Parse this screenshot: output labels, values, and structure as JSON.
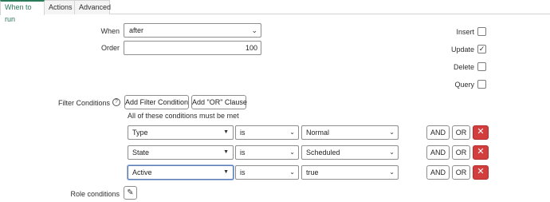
{
  "tabs": [
    "When to run",
    "Actions",
    "Advanced"
  ],
  "form": {
    "when_label": "When",
    "when_value": "after",
    "order_label": "Order",
    "order_value": "100",
    "insert_label": "Insert",
    "update_label": "Update",
    "delete_label": "Delete",
    "query_label": "Query",
    "insert_checked": false,
    "update_checked": true,
    "delete_checked": false,
    "query_checked": false,
    "filter_label": "Filter Conditions",
    "add_filter_label": "Add Filter Condition",
    "add_or_label": "Add \"OR\" Clause",
    "conditions_note": "All of these conditions must be met",
    "and_label": "AND",
    "or_label": "OR",
    "delete_glyph": "✕",
    "role_label": "Role conditions"
  },
  "conditions": [
    {
      "field": "Type",
      "operator": "is",
      "value": "Normal"
    },
    {
      "field": "State",
      "operator": "is",
      "value": "Scheduled"
    },
    {
      "field": "Active",
      "operator": "is",
      "value": "true"
    }
  ],
  "colors": {
    "accent": "#2b7a5a",
    "danger": "#d23d3d"
  },
  "icons": [
    "chevron-down-icon",
    "help-icon",
    "checkmark-icon",
    "close-icon",
    "pencil-icon"
  ]
}
